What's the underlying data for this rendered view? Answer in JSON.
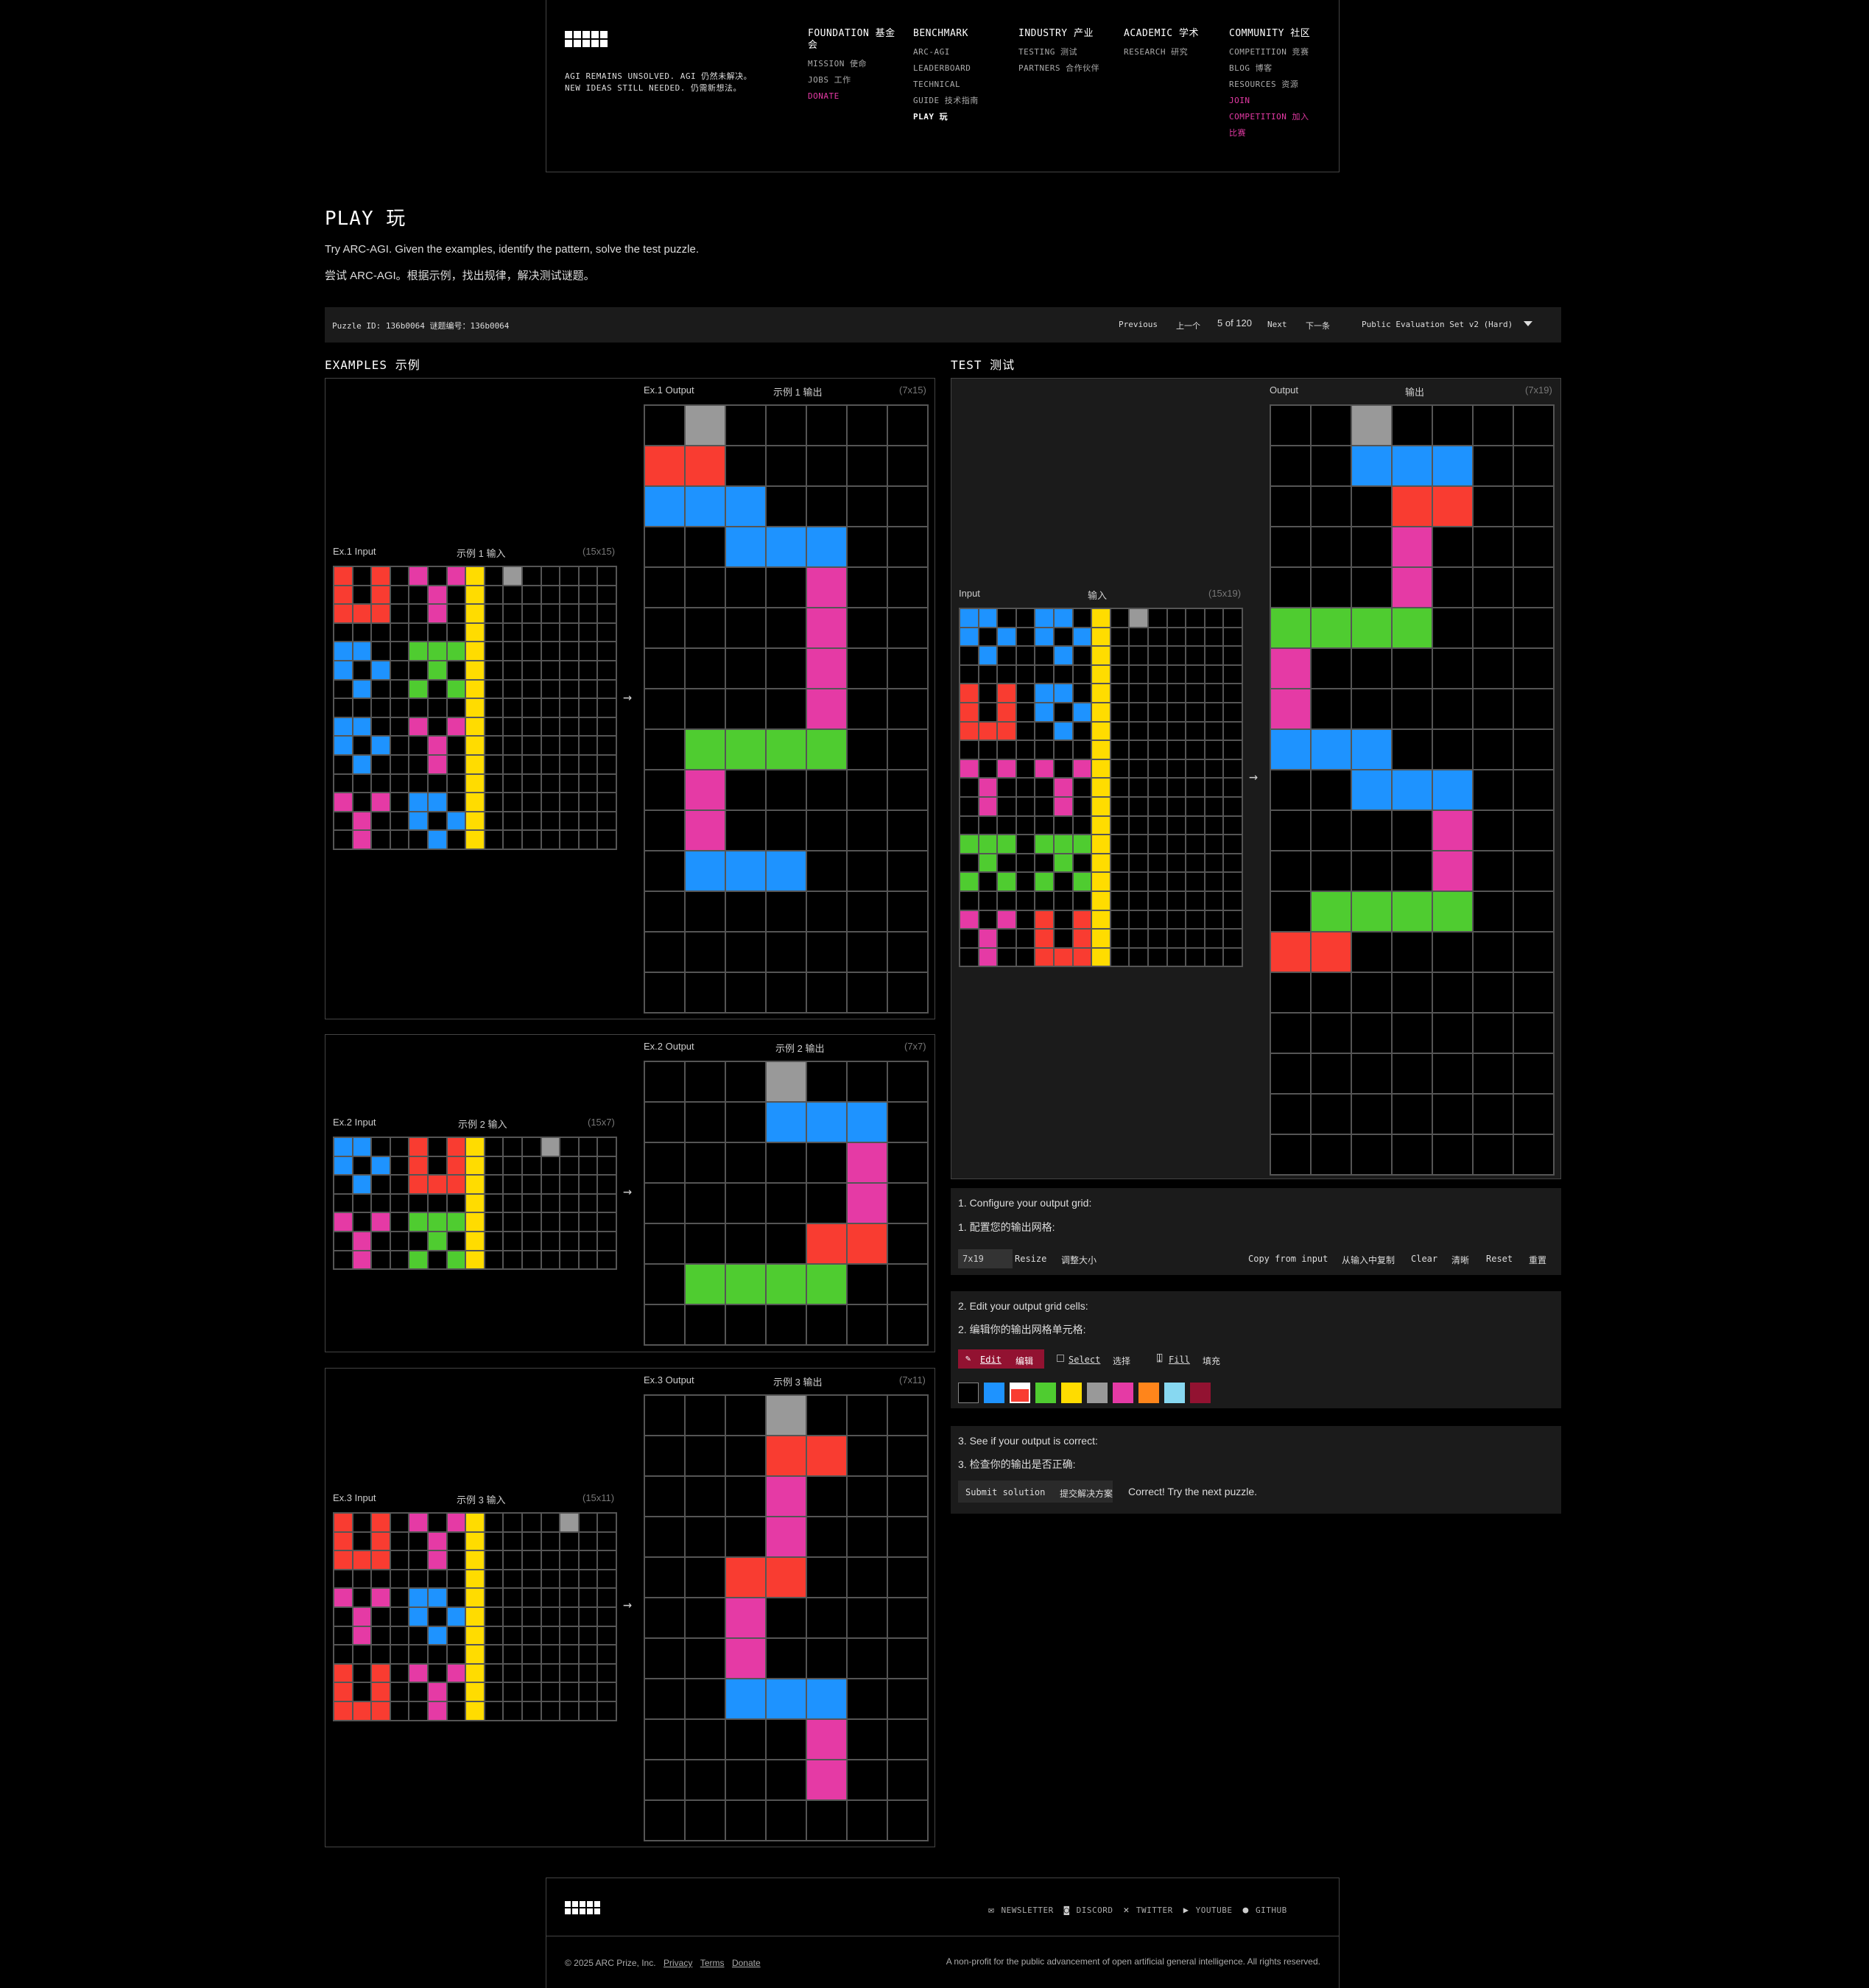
{
  "header": {
    "tagline_line1": "AGI REMAINS UNSOLVED.  AGI 仍然未解决。",
    "tagline_line2": "NEW IDEAS STILL NEEDED.  仍需新想法。",
    "nav": [
      {
        "title": "FOUNDATION  基金会",
        "items": [
          {
            "label": "MISSION  使命"
          },
          {
            "label": "JOBS  工作"
          },
          {
            "label": "DONATE",
            "style": "pink"
          }
        ]
      },
      {
        "title": "BENCHMARK",
        "items": [
          {
            "label": "ARC-AGI"
          },
          {
            "label": "LEADERBOARD"
          },
          {
            "label": "TECHNICAL"
          },
          {
            "label": "GUIDE  技术指南"
          },
          {
            "label": "PLAY  玩",
            "style": "active"
          }
        ]
      },
      {
        "title": "INDUSTRY  产业",
        "items": [
          {
            "label": "TESTING  测试"
          },
          {
            "label": "PARTNERS  合作伙伴"
          }
        ]
      },
      {
        "title": "ACADEMIC  学术",
        "items": [
          {
            "label": "RESEARCH  研究"
          }
        ]
      },
      {
        "title": "COMMUNITY  社区",
        "items": [
          {
            "label": "COMPETITION  竞赛"
          },
          {
            "label": "BLOG  博客"
          },
          {
            "label": "RESOURCES  资源"
          },
          {
            "label": "JOIN",
            "style": "pink"
          },
          {
            "label": "COMPETITION  加入",
            "style": "pink"
          },
          {
            "label": "比赛",
            "style": "pink"
          }
        ]
      }
    ]
  },
  "page": {
    "title": "PLAY  玩",
    "intro_en": "Try ARC-AGI. Given the examples, identify the pattern, solve the test puzzle.",
    "intro_zh": "尝试 ARC-AGI。根据示例，找出规律，解决测试谜题。"
  },
  "controls": {
    "puzzle_id": "Puzzle ID: 136b0064  谜题编号：136b0064",
    "previous": "Previous",
    "previous_zh": "上一个",
    "counter": "5 of 120",
    "next": "Next",
    "next_zh": "下一条",
    "set_select": "Public Evaluation Set v2 (Hard)"
  },
  "palette": {
    "k": "#000000",
    "B": "#1E93FF",
    "R": "#F93C31",
    "G": "#4FCC30",
    "Y": "#FFDC00",
    "S": "#999999",
    "P": "#E53AA5",
    "O": "#FF851B",
    "C": "#87D8F1",
    "M": "#921231"
  },
  "examples": {
    "title": "EXAMPLES  示例",
    "pairs": [
      {
        "input_label": "Ex.1 Input",
        "input_label_zh": "示例 1 输入",
        "input_dim": "(15x15)",
        "output_label": "Ex.1 Output",
        "output_label_zh": "示例 1 输出",
        "output_dim": "(7x15)",
        "input": [
          "RkRkPkPYkSkkkkk",
          "RkRkkPkYkkkkkkk",
          "RRRkkPkYkkkkkkk",
          "kkkkkkkYkkkkkkk",
          "BBkkGGGYkkkkkkk",
          "BkBkkGkYkkkkkkk",
          "kBkkGkGYkkkkkkk",
          "kkkkkkkYkkkkkkk",
          "BBkkPkPYkkkkkkk",
          "BkBkkPkYkkkkkkk",
          "kBkkkPkYkkkkkkk",
          "kkkkkkkYkkkkkkk",
          "PkPkBBkYkkkkkkk",
          "kPkkBkBYkkkkkkk",
          "kPkkkBkYkkkkkkk"
        ],
        "output": [
          "kSkkkkk",
          "RRkkkkk",
          "BBBkkkk",
          "kkBBBkk",
          "kkkkPkk",
          "kkkkPkk",
          "kkkkPkk",
          "kkkkPkk",
          "kGGGGkk",
          "kPkkkkk",
          "kPkkkkk",
          "kBBBkkk",
          "kkkkkkk",
          "kkkkkkk",
          "kkkkkkk"
        ]
      },
      {
        "input_label": "Ex.2 Input",
        "input_label_zh": "示例 2 输入",
        "input_dim": "(15x7)",
        "output_label": "Ex.2 Output",
        "output_label_zh": "示例 2 输出",
        "output_dim": "(7x7)",
        "input": [
          "BBkkRkRYkkkSkkk",
          "BkBkRkRYkkkkkkk",
          "kBkkRRRYkkkkkkk",
          "kkkkkkkYkkkkkkk",
          "PkPkGGGYkkkkkkk",
          "kPkkkGkYkkkkkkk",
          "kPkkGkGYkkkkkkk"
        ],
        "output": [
          "kkkSkkk",
          "kkkBBBk",
          "kkkkkPk",
          "kkkkkPk",
          "kkkkRRk",
          "kGGGGkk",
          "kkkkkkk"
        ]
      },
      {
        "input_label": "Ex.3 Input",
        "input_label_zh": "示例 3 输入",
        "input_dim": "(15x11)",
        "output_label": "Ex.3 Output",
        "output_label_zh": "示例 3 输出",
        "output_dim": "(7x11)",
        "input": [
          "RkRkPkPYkkkkSkk",
          "RkRkkPkYkkkkkkk",
          "RRRkkPkYkkkkkkk",
          "kkkkkkkYkkkkkkk",
          "PkPkBBkYkkkkkkk",
          "kPkkBkBYkkkkkkk",
          "kPkkkBkYkkkkkkk",
          "kkkkkkkYkkkkkkk",
          "RkRkPkPYkkkkkkk",
          "RkRkkPkYkkkkkkk",
          "RRRkkPkYkkkkkkk"
        ],
        "output": [
          "kkkSkkk",
          "kkkRRkk",
          "kkkPkkk",
          "kkkPkkk",
          "kkRRkkk",
          "kkPkkkk",
          "kkPkkkk",
          "kkBBBkk",
          "kkkkPkk",
          "kkkkPkk",
          "kkkkkkk"
        ]
      }
    ]
  },
  "test": {
    "title": "TEST  测试",
    "input_label": "Input",
    "input_label_zh": "输入",
    "input_dim": "(15x19)",
    "output_label": "Output",
    "output_label_zh": "输出",
    "output_dim": "(7x19)",
    "input": [
      "BBkkBBkYkSkkkkk",
      "BkBkBkBYkkkkkkk",
      "kBkkkBkYkkkkkkk",
      "kkkkkkkYkkkkkkk",
      "RkRkBBkYkkkkkkk",
      "RkRkBkBYkkkkkkk",
      "RRRkkBkYkkkkkkk",
      "kkkkkkkYkkkkkkk",
      "PkPkPkPYkkkkkkk",
      "kPkkkPkYkkkkkkk",
      "kPkkkPkYkkkkkkk",
      "kkkkkkkYkkkkkkk",
      "GGGkGGGYkkkkkkk",
      "kGkkkGkYkkkkkkk",
      "GkGkGkGYkkkkkkk",
      "kkkkkkkYkkkkkkk",
      "PkPkRkRYkkkkkkk",
      "kPkkRkRYkkkkkkk",
      "kPkkRRRYkkkkkkk"
    ],
    "output": [
      "kkSkkkk",
      "kkBBBkk",
      "kkkRRkk",
      "kkkPkkk",
      "kkkPkkk",
      "GGGGkkk",
      "Pkkkkkk",
      "Pkkkkkk",
      "BBBkkkk",
      "kkBBBkk",
      "kkkkPkk",
      "kkkkPkk",
      "kGGGGkk",
      "RRkkkkk",
      "kkkkkkk",
      "kkkkkkk",
      "kkkkkkk",
      "kkkkkkk",
      "kkkkkkk"
    ]
  },
  "steps": {
    "step1_en": "1. Configure your output grid:",
    "step1_zh": "1. 配置您的输出网格:",
    "size_value": "7x19",
    "resize": "Resize",
    "resize_zh": "调整大小",
    "copy": "Copy from input",
    "copy_zh": "从输入中复制",
    "clear": "Clear",
    "clear_zh": "清晰",
    "reset": "Reset",
    "reset_zh": "重置",
    "step2_en": "2. Edit your output grid cells:",
    "step2_zh": "2. 编辑你的输出网格单元格:",
    "edit": "Edit",
    "edit_zh": "编辑",
    "select": "Select",
    "select_zh": "选择",
    "fill": "Fill",
    "fill_zh": "填充",
    "step3_en": "3. See if your output is correct:",
    "step3_zh": "3. 检查你的输出是否正确:",
    "submit": "Submit solution",
    "submit_zh": "提交解决方案",
    "result": "Correct! Try the next puzzle."
  },
  "footer": {
    "links": [
      "NEWSLETTER",
      "DISCORD",
      "TWITTER",
      "YOUTUBE",
      "GITHUB"
    ],
    "copyright": "© 2025 ARC Prize, Inc.",
    "privacy": "Privacy",
    "terms": "Terms",
    "donate": "Donate",
    "mission": "A non-profit for the public advancement of open artificial general intelligence. All rights reserved."
  }
}
